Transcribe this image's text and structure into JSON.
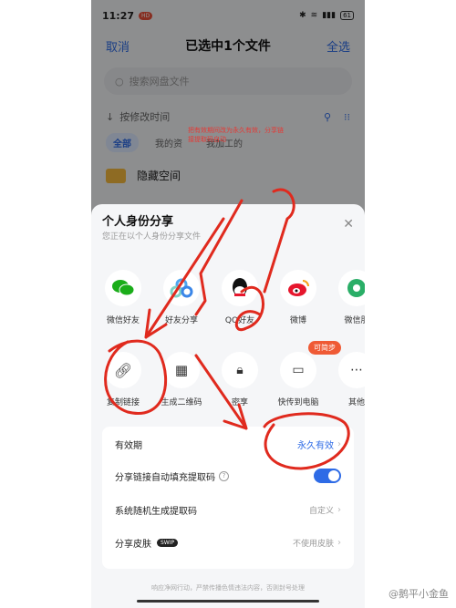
{
  "status_bar": {
    "time": "11:27",
    "hd_badge": "HD",
    "battery": "61"
  },
  "header": {
    "cancel": "取消",
    "title": "已选中1个文件",
    "select_all": "全选"
  },
  "search": {
    "placeholder": "搜索网盘文件"
  },
  "sort": {
    "label": "按修改时间"
  },
  "filters": [
    "全部",
    "我的资",
    "我加工的"
  ],
  "hidden_space": "隐藏空间",
  "sheet": {
    "title": "个人身份分享",
    "subtitle": "您正在以个人身份分享文件",
    "share_targets": [
      {
        "label": "微信好友",
        "icon": "wechat-icon",
        "color": "#1aad19"
      },
      {
        "label": "好友分享",
        "icon": "friend-share-icon",
        "color": "#4fa7ef"
      },
      {
        "label": "QQ好友",
        "icon": "qq-icon",
        "color": "#111111"
      },
      {
        "label": "微博",
        "icon": "weibo-icon",
        "color": "#e6162d"
      },
      {
        "label": "微信朋",
        "icon": "moments-icon",
        "color": "#2aae67"
      }
    ],
    "actions": [
      {
        "label": "复制链接",
        "icon": "link-icon"
      },
      {
        "label": "生成二维码",
        "icon": "qrcode-icon"
      },
      {
        "label": "密享",
        "icon": "lock-icon"
      },
      {
        "label": "快传到电脑",
        "icon": "computer-icon"
      },
      {
        "label": "其他",
        "icon": "more-icon"
      }
    ],
    "tag": "可简步",
    "settings": {
      "validity_label": "有效期",
      "validity_value": "永久有效",
      "autofill_label": "分享链接自动填充提取码",
      "random_label": "系统随机生成提取码",
      "random_value": "自定义",
      "skin_label": "分享皮肤",
      "skin_badge": "SWIP",
      "skin_value": "不使用皮肤"
    },
    "footer": "响应净网行动，严禁传播色情违法内容，否则封号处理"
  },
  "annotation_note": "把有效期间改为永久有效，分享链接提取码自动",
  "watermark": "@鹅平小金鱼"
}
